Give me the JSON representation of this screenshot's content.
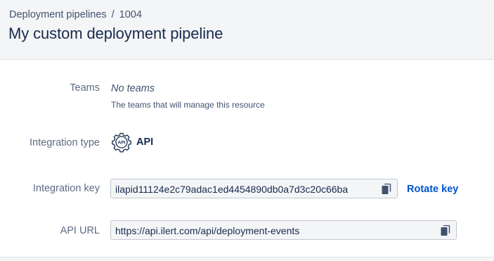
{
  "breadcrumb": {
    "parent": "Deployment pipelines",
    "separator": "/",
    "current": "1004"
  },
  "page": {
    "title": "My custom deployment pipeline"
  },
  "teams": {
    "label": "Teams",
    "value": "No teams",
    "help": "The teams that will manage this resource"
  },
  "integration_type": {
    "label": "Integration type",
    "icon": "api-gear-icon",
    "icon_text": "API",
    "value": "API"
  },
  "integration_key": {
    "label": "Integration key",
    "value": "ilapid11124e2c79adac1ed4454890db0a7d3c20c66ba",
    "copy_icon": "copy-icon",
    "rotate_label": "Rotate key"
  },
  "api_url": {
    "label": "API URL",
    "value": "https://api.ilert.com/api/deployment-events",
    "copy_icon": "copy-icon"
  },
  "colors": {
    "link": "#0052cc",
    "text": "#172b4d",
    "muted": "#5e6c84",
    "field_bg": "#f4f5f7",
    "field_border": "#c1c7d0"
  }
}
